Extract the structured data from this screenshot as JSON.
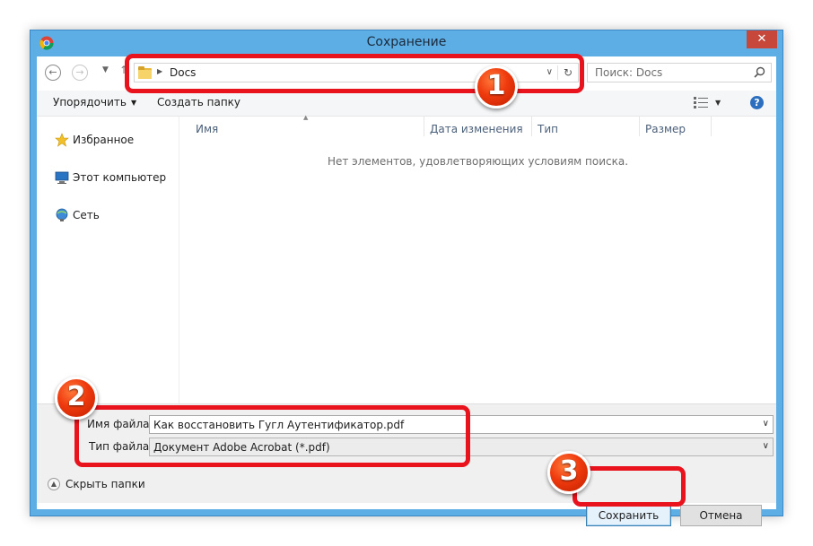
{
  "window": {
    "title": "Сохранение",
    "close_glyph": "✕"
  },
  "address": {
    "path": [
      "Docs"
    ]
  },
  "search": {
    "placeholder": "Поиск: Docs"
  },
  "toolbar": {
    "organize_label": "Упорядочить",
    "new_folder_label": "Создать папку",
    "help_glyph": "?"
  },
  "navpane": {
    "items": [
      {
        "label": "Избранное",
        "icon": "star-icon"
      },
      {
        "label": "Этот компьютер",
        "icon": "computer-icon"
      },
      {
        "label": "Сеть",
        "icon": "network-icon"
      }
    ]
  },
  "content": {
    "columns": [
      "Имя",
      "Дата изменения",
      "Тип",
      "Размер"
    ],
    "empty_message": "Нет элементов, удовлетворяющих условиям поиска."
  },
  "form": {
    "filename_label": "Имя файла:",
    "filename_value": "Как восстановить Гугл Аутентификатор.pdf",
    "filetype_label": "Тип файла:",
    "filetype_value": "Документ Adobe Acrobat (*.pdf)"
  },
  "footer": {
    "hide_folders_label": "Скрыть папки",
    "save_label": "Сохранить",
    "cancel_label": "Отмена"
  },
  "annotations": {
    "badges": [
      "1",
      "2",
      "3"
    ],
    "color": "#e8131c"
  },
  "colors": {
    "titlebar": "#5eaee6",
    "close_button": "#c7473a",
    "column_header_text": "#4c607a"
  }
}
